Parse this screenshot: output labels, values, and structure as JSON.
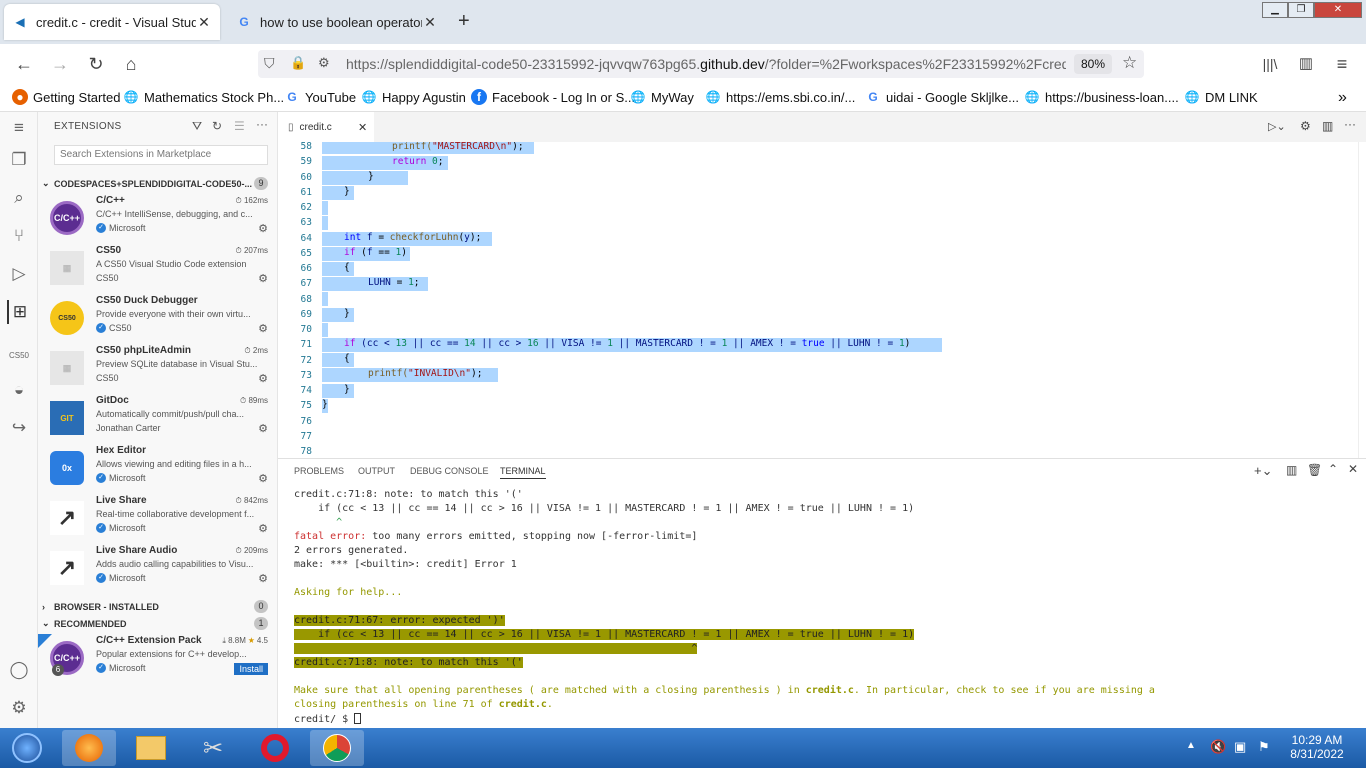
{
  "browser": {
    "tabs": [
      {
        "title": "credit.c - credit - Visual Studio C",
        "active": true
      },
      {
        "title": "how to use boolean operator in",
        "active": false
      }
    ],
    "url_prefix": "https://splendiddigital-code50-23315992-jqvvqw763pg65.",
    "url_domain": "github.dev",
    "url_suffix": "/?folder=%2Fworkspaces%2F23315992%2Fcred",
    "zoom": "80%",
    "bookmarks": [
      "Getting Started",
      "Mathematics Stock Ph...",
      "YouTube",
      "Happy Agustin",
      "Facebook - Log In or S...",
      "MyWay",
      "https://ems.sbi.co.in/...",
      "uidai - Google Skljlke...",
      "https://business-loan....",
      "DM LINK"
    ]
  },
  "sidebar": {
    "title": "EXTENSIONS",
    "search_placeholder": "Search Extensions in Marketplace",
    "section1": {
      "label": "CODESPACES+SPLENDIDDIGITAL-CODE50-...",
      "count": "9"
    },
    "extensions": [
      {
        "name": "C/C++",
        "time": "162ms",
        "desc": "C/C++ IntelliSense, debugging, and c...",
        "publisher": "Microsoft",
        "logo": "C/C++"
      },
      {
        "name": "CS50",
        "time": "207ms",
        "desc": "A CS50 Visual Studio Code extension",
        "publisher": "CS50",
        "logo": ""
      },
      {
        "name": "CS50 Duck Debugger",
        "time": "",
        "desc": "Provide everyone with their own virtu...",
        "publisher": "CS50",
        "logo": "CS50"
      },
      {
        "name": "CS50 phpLiteAdmin",
        "time": "2ms",
        "desc": "Preview SQLite database in Visual Stu...",
        "publisher": "CS50",
        "logo": ""
      },
      {
        "name": "GitDoc",
        "time": "89ms",
        "desc": "Automatically commit/push/pull cha...",
        "publisher": "Jonathan Carter",
        "logo": "GIT"
      },
      {
        "name": "Hex Editor",
        "time": "",
        "desc": "Allows viewing and editing files in a h...",
        "publisher": "Microsoft",
        "logo": "0x"
      },
      {
        "name": "Live Share",
        "time": "842ms",
        "desc": "Real-time collaborative development f...",
        "publisher": "Microsoft",
        "logo": ""
      },
      {
        "name": "Live Share Audio",
        "time": "209ms",
        "desc": "Adds audio calling capabilities to Visu...",
        "publisher": "Microsoft",
        "logo": ""
      }
    ],
    "section2": {
      "label": "BROWSER - INSTALLED",
      "count": "0"
    },
    "section3": {
      "label": "RECOMMENDED",
      "count": "1"
    },
    "recommended": {
      "name": "C/C++ Extension Pack",
      "downloads": "8.8M",
      "rating": "4.5",
      "desc": "Popular extensions for C++ develop...",
      "publisher": "Microsoft",
      "install": "Install",
      "badge": "6",
      "logo": "C/C++"
    }
  },
  "editor": {
    "file_tab": "credit.c",
    "line_numbers": [
      "58",
      "59",
      "60",
      "61",
      "62",
      "63",
      "64",
      "65",
      "66",
      "67",
      "68",
      "69",
      "70",
      "71",
      "72",
      "73",
      "74",
      "75",
      "76",
      "77",
      "78"
    ],
    "code": {
      "l58a": "printf(",
      "l58b": "\"MASTERCARD\\n\"",
      "l58c": ");",
      "l59a": "return ",
      "l59b": "0",
      "l59c": ";",
      "l60": "}",
      "l61": "}",
      "l64a": "int ",
      "l64b": "f",
      "l64c": " = ",
      "l64d": "checkforLuhn",
      "l64e": "(",
      "l64f": "y",
      "l64g": ");",
      "l65a": "if ",
      "l65b": "(",
      "l65c": "f",
      "l65d": " == ",
      "l65e": "1",
      "l65f": ")",
      "l66": "{",
      "l67a": "LUHN",
      "l67b": " = ",
      "l67c": "1",
      "l67d": ";",
      "l69": "}",
      "l71a": "if ",
      "l71b": "(cc < ",
      "l71c": "13",
      "l71d": " || cc == ",
      "l71e": "14",
      "l71f": " || cc > ",
      "l71g": "16",
      "l71h": " || VISA != ",
      "l71i": "1",
      "l71j": " || MASTERCARD ! = ",
      "l71k": "1",
      "l71l": " || AMEX ! = ",
      "l71m": "true",
      "l71n": " || LUHN ! = ",
      "l71o": "1",
      "l71p": ")",
      "l72": "{",
      "l73a": "printf(",
      "l73b": "\"INVALID\\n\"",
      "l73c": ");",
      "l74": "}",
      "l75": "}"
    }
  },
  "panel": {
    "tabs": [
      "PROBLEMS",
      "OUTPUT",
      "DEBUG CONSOLE",
      "TERMINAL"
    ],
    "terminal": {
      "t1": "credit.c:71:8: note: to match this '('",
      "t2": "    if (cc < 13 || cc == 14 || cc > 16 || VISA != 1 || MASTERCARD ! = 1 || AMEX ! = true || LUHN ! = 1)",
      "t3": "       ^",
      "t4a": "fatal error: ",
      "t4b": "too many errors emitted, stopping now [-ferror-limit=]",
      "t5": "2 errors generated.",
      "t6": "make: *** [<builtin>: credit] Error 1",
      "t7": "Asking for help...",
      "t8": "credit.c:71:67: error: expected ')'",
      "t9": "    if (cc < 13 || cc == 14 || cc > 16 || VISA != 1 || MASTERCARD ! = 1 || AMEX ! = true || LUHN ! = 1)",
      "t10": "                                                                  ^",
      "t11": "credit.c:71:8: note: to match this '('",
      "t12a": "Make sure that all opening parentheses ( are matched with a closing parenthesis ) in ",
      "t12b": "credit.c",
      "t12c": ". In particular, check to see if you are missing a",
      "t13a": "closing parenthesis on line 71 of ",
      "t13b": "credit.c",
      "t13c": ".",
      "t14": "credit/ $ "
    }
  },
  "taskbar": {
    "time": "10:29 AM",
    "date": "8/31/2022"
  }
}
